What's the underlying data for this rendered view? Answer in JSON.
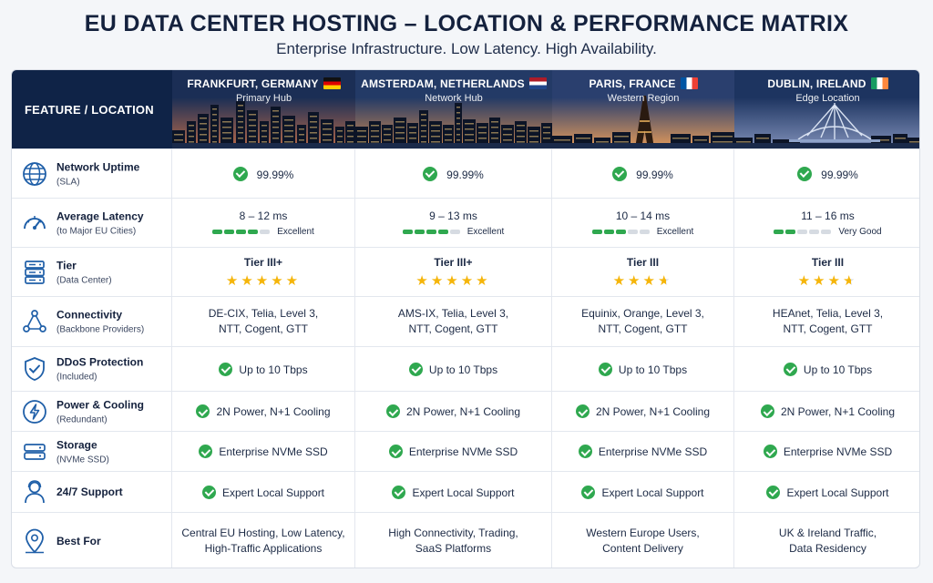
{
  "title": "EU DATA CENTER HOSTING – LOCATION & PERFORMANCE MATRIX",
  "subtitle": "Enterprise Infrastructure. Low Latency. High Availability.",
  "header": {
    "feature_label": "FEATURE / LOCATION",
    "locations": [
      {
        "name": "FRANKFURT, GERMANY",
        "role": "Primary Hub",
        "flag": "de",
        "sky": [
          "#1b2e55",
          "#b86a4a"
        ]
      },
      {
        "name": "AMSTERDAM, NETHERLANDS",
        "role": "Network Hub",
        "flag": "nl",
        "sky": [
          "#233a66",
          "#d08a52"
        ]
      },
      {
        "name": "PARIS, FRANCE",
        "role": "Western Region",
        "flag": "fr",
        "sky": [
          "#2a3f6e",
          "#e39a5a"
        ]
      },
      {
        "name": "DUBLIN, IRELAND",
        "role": "Edge Location",
        "flag": "ie",
        "sky": [
          "#1d3460",
          "#7f8fb8"
        ]
      }
    ]
  },
  "rows": [
    {
      "key": "uptime",
      "icon": "globe-icon",
      "label": "Network Uptime",
      "sub": "(SLA)",
      "values": [
        "99.99%",
        "99.99%",
        "99.99%",
        "99.99%"
      ]
    },
    {
      "key": "latency",
      "icon": "gauge-icon",
      "label": "Average Latency",
      "sub": "(to Major EU Cities)",
      "values": [
        {
          "range": "8 – 12 ms",
          "rating": "Excellent",
          "level": 0.8
        },
        {
          "range": "9 – 13 ms",
          "rating": "Excellent",
          "level": 0.8
        },
        {
          "range": "10 – 14 ms",
          "rating": "Excellent",
          "level": 0.6
        },
        {
          "range": "11 – 16 ms",
          "rating": "Very Good",
          "level": 0.4
        }
      ]
    },
    {
      "key": "tier",
      "icon": "server-rack-icon",
      "label": "Tier",
      "sub": "(Data Center)",
      "values": [
        {
          "tier": "Tier III+",
          "stars": 5
        },
        {
          "tier": "Tier III+",
          "stars": 5
        },
        {
          "tier": "Tier III",
          "stars": 3.5
        },
        {
          "tier": "Tier III",
          "stars": 3.5
        }
      ]
    },
    {
      "key": "connectivity",
      "icon": "network-nodes-icon",
      "label": "Connectivity",
      "sub": "(Backbone Providers)",
      "values": [
        [
          "DE-CIX, Telia, Level 3,",
          "NTT, Cogent, GTT"
        ],
        [
          "AMS-IX, Telia, Level 3,",
          "NTT, Cogent, GTT"
        ],
        [
          "Equinix, Orange, Level 3,",
          "NTT, Cogent, GTT"
        ],
        [
          "HEAnet, Telia, Level 3,",
          "NTT, Cogent, GTT"
        ]
      ]
    },
    {
      "key": "ddos",
      "icon": "shield-check-icon",
      "label": "DDoS Protection",
      "sub": "(Included)",
      "values": [
        "Up to 10 Tbps",
        "Up to 10 Tbps",
        "Up to 10 Tbps",
        "Up to 10 Tbps"
      ]
    },
    {
      "key": "power",
      "icon": "lightning-icon",
      "label": "Power & Cooling",
      "sub": "(Redundant)",
      "values": [
        "2N Power, N+1 Cooling",
        "2N Power, N+1 Cooling",
        "2N Power, N+1 Cooling",
        "2N Power, N+1 Cooling"
      ]
    },
    {
      "key": "storage",
      "icon": "drive-icon",
      "label": "Storage",
      "sub": "(NVMe SSD)",
      "values": [
        "Enterprise NVMe SSD",
        "Enterprise NVMe SSD",
        "Enterprise NVMe SSD",
        "Enterprise NVMe SSD"
      ]
    },
    {
      "key": "support",
      "icon": "support-user-icon",
      "label": "24/7 Support",
      "sub": "",
      "values": [
        "Expert Local Support",
        "Expert Local Support",
        "Expert Local Support",
        "Expert Local Support"
      ]
    },
    {
      "key": "bestfor",
      "icon": "location-pin-icon",
      "label": "Best For",
      "sub": "",
      "values": [
        [
          "Central EU Hosting, Low Latency,",
          "High-Traffic Applications"
        ],
        [
          "High Connectivity, Trading,",
          "SaaS Platforms"
        ],
        [
          "Western Europe Users,",
          "Content Delivery"
        ],
        [
          "UK & Ireland Traffic,",
          "Data Residency"
        ]
      ]
    }
  ],
  "colors": {
    "accent": "#0f2347",
    "check": "#2fa84f",
    "star": "#f5b50a",
    "icon": "#1f5fa8"
  }
}
